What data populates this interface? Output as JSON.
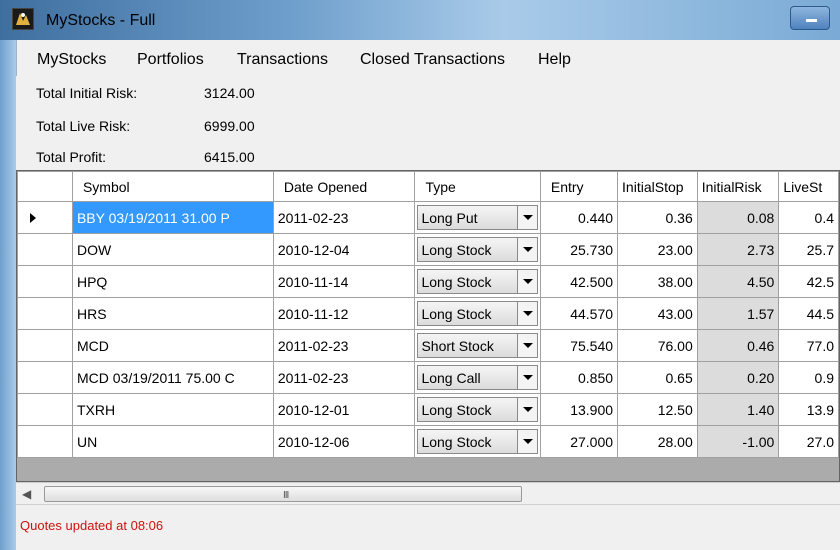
{
  "window": {
    "title": "MyStocks - Full"
  },
  "menu": [
    "MyStocks",
    "Portfolios",
    "Transactions",
    "Closed Transactions",
    "Help"
  ],
  "summary": [
    {
      "label": "Total Initial Risk:",
      "value": "3124.00"
    },
    {
      "label": "Total Live Risk:",
      "value": "6999.00"
    },
    {
      "label": "Total Profit:",
      "value": "6415.00"
    }
  ],
  "grid": {
    "columns": [
      "Symbol",
      "Date Opened",
      "Type",
      "Entry",
      "InitialStop",
      "InitialRisk",
      "LiveSt"
    ],
    "rows": [
      {
        "symbol": "BBY 03/19/2011 31.00 P",
        "date": "2011-02-23",
        "type": "Long Put",
        "entry": "0.440",
        "initial_stop": "0.36",
        "initial_risk": "0.08",
        "live_stop": "0.4"
      },
      {
        "symbol": "DOW",
        "date": "2010-12-04",
        "type": "Long Stock",
        "entry": "25.730",
        "initial_stop": "23.00",
        "initial_risk": "2.73",
        "live_stop": "25.7"
      },
      {
        "symbol": "HPQ",
        "date": "2010-11-14",
        "type": "Long Stock",
        "entry": "42.500",
        "initial_stop": "38.00",
        "initial_risk": "4.50",
        "live_stop": "42.5"
      },
      {
        "symbol": "HRS",
        "date": "2010-11-12",
        "type": "Long Stock",
        "entry": "44.570",
        "initial_stop": "43.00",
        "initial_risk": "1.57",
        "live_stop": "44.5"
      },
      {
        "symbol": "MCD",
        "date": "2011-02-23",
        "type": "Short Stock",
        "entry": "75.540",
        "initial_stop": "76.00",
        "initial_risk": "0.46",
        "live_stop": "77.0"
      },
      {
        "symbol": "MCD 03/19/2011 75.00 C",
        "date": "2011-02-23",
        "type": "Long Call",
        "entry": "0.850",
        "initial_stop": "0.65",
        "initial_risk": "0.20",
        "live_stop": "0.9"
      },
      {
        "symbol": "TXRH",
        "date": "2010-12-01",
        "type": "Long Stock",
        "entry": "13.900",
        "initial_stop": "12.50",
        "initial_risk": "1.40",
        "live_stop": "13.9"
      },
      {
        "symbol": "UN",
        "date": "2010-12-06",
        "type": "Long Stock",
        "entry": "27.000",
        "initial_stop": "28.00",
        "initial_risk": "-1.00",
        "live_stop": "27.0"
      }
    ]
  },
  "scrollbar": {
    "grip": "III"
  },
  "status": {
    "text": "Quotes updated at 08:06",
    "color": "#d01010"
  },
  "colors": {
    "selection": "#3399ff",
    "risk_cell": "#dcdcdc"
  },
  "icons": {
    "app": "app-logo-icon",
    "minimize": "minimize-icon",
    "row_indicator": "current-row-arrow-icon",
    "combo": "chevron-down-icon",
    "scroll_left": "scroll-left-arrow-icon"
  }
}
